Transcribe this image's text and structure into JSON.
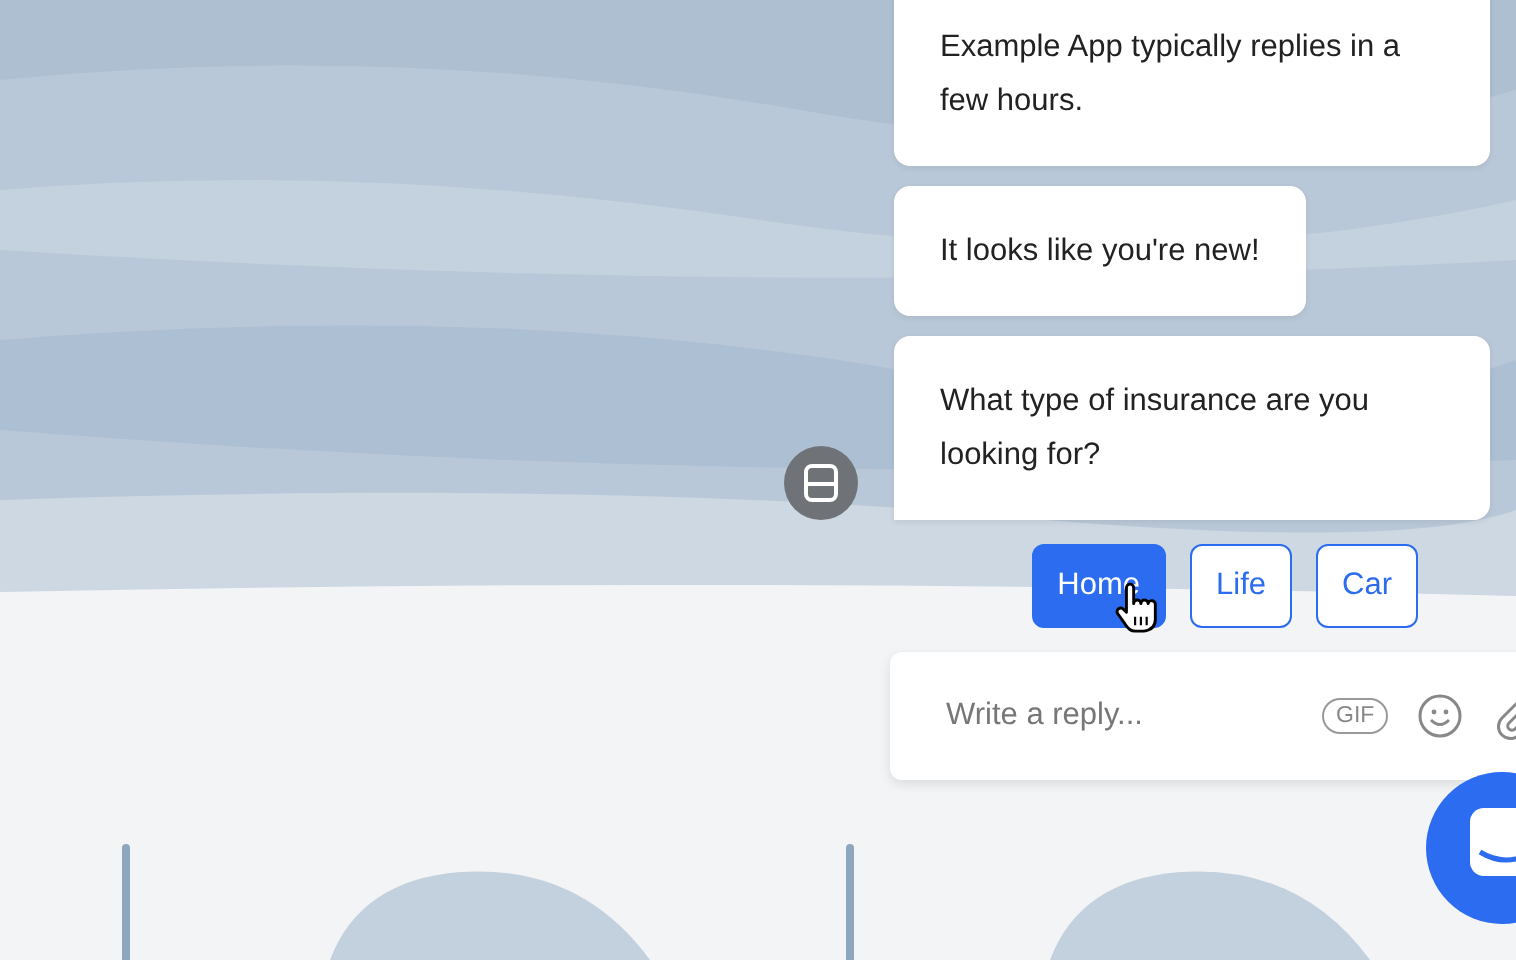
{
  "messages": [
    {
      "text": "Example App typically replies in a few hours."
    },
    {
      "text": "It looks like you're new!"
    },
    {
      "text": "What type of insurance are you looking for?"
    }
  ],
  "quick_replies": [
    {
      "label": "Home",
      "selected": true
    },
    {
      "label": "Life",
      "selected": false
    },
    {
      "label": "Car",
      "selected": false
    }
  ],
  "composer": {
    "placeholder": "Write a reply...",
    "gif_label": "GIF"
  }
}
